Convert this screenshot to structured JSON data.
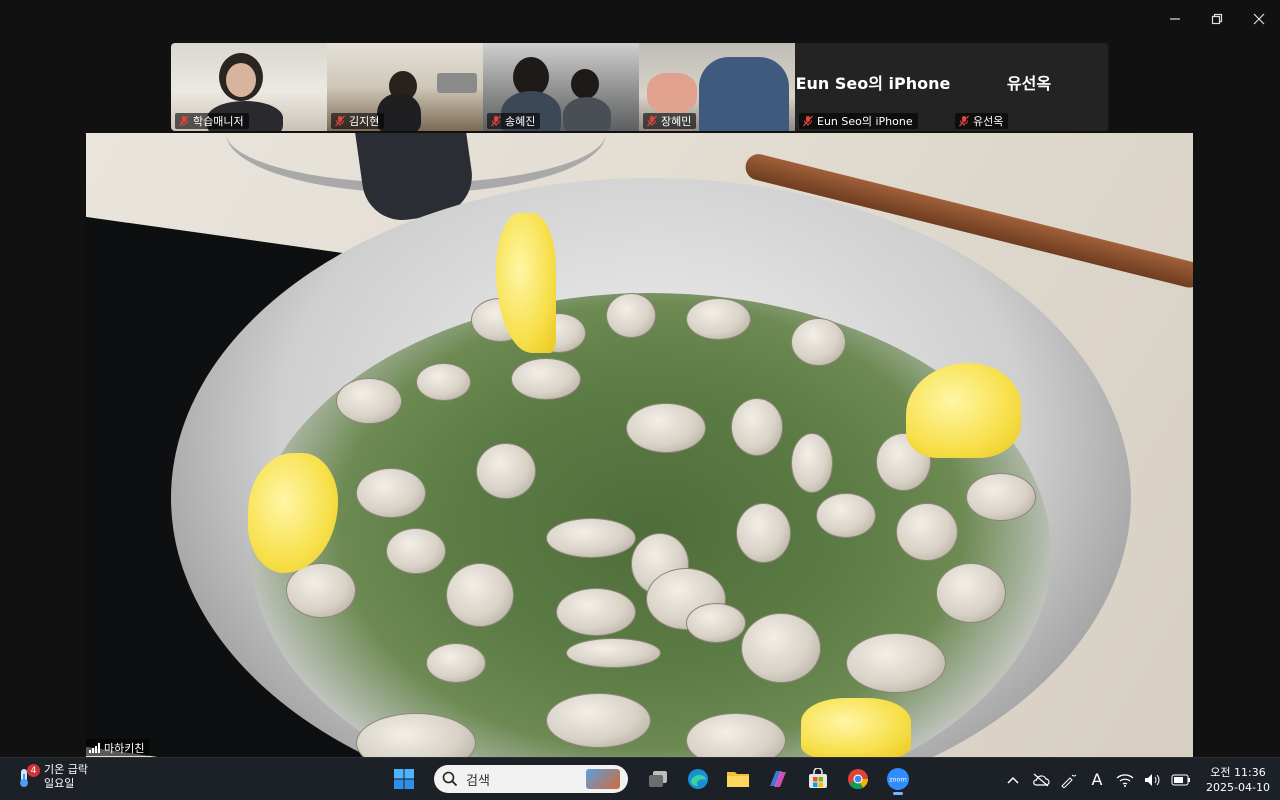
{
  "window": {
    "controls": {
      "minimize": "—",
      "restore": "❐",
      "close": "✕"
    }
  },
  "gallery": [
    {
      "name": "학습매니저",
      "muted": true,
      "scene": "scene1"
    },
    {
      "name": "김지현",
      "muted": true,
      "scene": "scene2"
    },
    {
      "name": "송혜진",
      "muted": true,
      "scene": "scene3"
    },
    {
      "name": "장혜민",
      "muted": true,
      "scene": "scene4"
    },
    {
      "name": "Eun Seo의 iPhone",
      "muted": true,
      "display_name": "Eun Seo의 iPhone"
    },
    {
      "name": "유선옥",
      "muted": true,
      "display_name": "유선옥"
    }
  ],
  "speaker": {
    "name": "마하키친"
  },
  "taskbar": {
    "weather": {
      "badge": "4",
      "line1": "기온 급락",
      "line2": "일요일"
    },
    "search": {
      "placeholder": "검색"
    },
    "clock": {
      "time": "오전 11:36",
      "date": "2025-04-10"
    },
    "ime": "A"
  },
  "colors": {
    "taskbar_bg": "#1c2027",
    "accent_active": "#7cb5ff",
    "mute_red": "#e0443e"
  }
}
